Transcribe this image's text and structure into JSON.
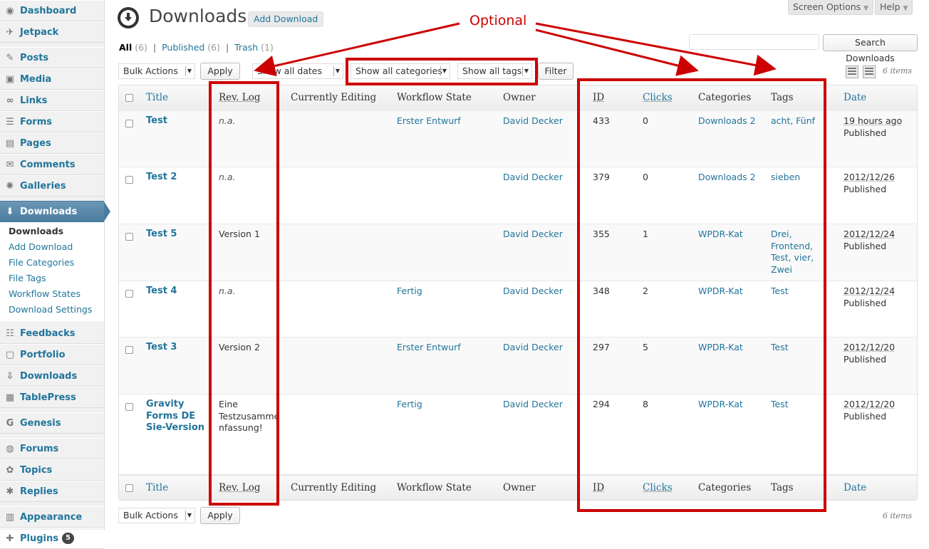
{
  "sidebar": {
    "menu": [
      {
        "label": "Dashboard",
        "icon": "dashboard-icon"
      },
      {
        "label": "Jetpack",
        "icon": "jetpack-icon"
      },
      {
        "label": "Posts",
        "icon": "pin-icon"
      },
      {
        "label": "Media",
        "icon": "media-icon"
      },
      {
        "label": "Links",
        "icon": "link-icon"
      },
      {
        "label": "Forms",
        "icon": "forms-icon"
      },
      {
        "label": "Pages",
        "icon": "pages-icon"
      },
      {
        "label": "Comments",
        "icon": "comment-icon"
      },
      {
        "label": "Galleries",
        "icon": "gallery-icon"
      },
      {
        "label": "Downloads",
        "icon": "download-icon"
      },
      {
        "label": "Feedbacks",
        "icon": "feedback-icon"
      },
      {
        "label": "Portfolio",
        "icon": "portfolio-icon"
      },
      {
        "label": "Downloads",
        "icon": "download-arrow-icon"
      },
      {
        "label": "TablePress",
        "icon": "table-icon"
      },
      {
        "label": "Genesis",
        "icon": "genesis-icon"
      },
      {
        "label": "Forums",
        "icon": "forums-icon"
      },
      {
        "label": "Topics",
        "icon": "topics-icon"
      },
      {
        "label": "Replies",
        "icon": "replies-icon"
      },
      {
        "label": "Appearance",
        "icon": "appearance-icon"
      },
      {
        "label": "Plugins",
        "icon": "plugin-icon",
        "badge": "5"
      }
    ],
    "submenu": [
      "Downloads",
      "Add Download",
      "File Categories",
      "File Tags",
      "Workflow States",
      "Download Settings"
    ]
  },
  "header": {
    "screen_options": "Screen Options",
    "help": "Help",
    "title": "Downloads",
    "add_new": "Add Download"
  },
  "views": {
    "all": "All",
    "all_count": "(6)",
    "published": "Published",
    "published_count": "(6)",
    "trash": "Trash",
    "trash_count": "(1)"
  },
  "search": {
    "button": "Search Downloads",
    "value": ""
  },
  "toolbar": {
    "bulk_actions": "Bulk Actions",
    "apply": "Apply",
    "dates": "Show all dates",
    "categories": "Show all categories",
    "tags": "Show all tags",
    "filter": "Filter",
    "items": "6 items"
  },
  "columns": {
    "title": "Title",
    "revlog": "Rev. Log",
    "editing": "Currently Editing",
    "workflow": "Workflow State",
    "owner": "Owner",
    "id": "ID",
    "clicks": "Clicks",
    "categories": "Categories",
    "tags": "Tags",
    "date": "Date"
  },
  "rows": [
    {
      "title": "Test",
      "revlog": "n.a.",
      "workflow": "Erster Entwurf",
      "owner": "David Decker",
      "id": "433",
      "clicks": "0",
      "categories": "Downloads 2",
      "tags": "acht, Fünf",
      "date": "19 hours ago",
      "status": "Published"
    },
    {
      "title": "Test 2",
      "revlog": "n.a.",
      "workflow": "",
      "owner": "David Decker",
      "id": "379",
      "clicks": "0",
      "categories": "Downloads 2",
      "tags": "sieben",
      "date": "2012/12/26",
      "status": "Published"
    },
    {
      "title": "Test 5",
      "revlog": "Version 1",
      "workflow": "",
      "owner": "David Decker",
      "id": "355",
      "clicks": "1",
      "categories": "WPDR-Kat",
      "tags": "Drei,\nFrontend,\nTest, vier,\nZwei",
      "date": "2012/12/24",
      "status": "Published"
    },
    {
      "title": "Test 4",
      "revlog": "n.a.",
      "workflow": "Fertig",
      "owner": "David Decker",
      "id": "348",
      "clicks": "2",
      "categories": "WPDR-Kat",
      "tags": "Test",
      "date": "2012/12/24",
      "status": "Published"
    },
    {
      "title": "Test 3",
      "revlog": "Version 2",
      "workflow": "Erster Entwurf",
      "owner": "David Decker",
      "id": "297",
      "clicks": "5",
      "categories": "WPDR-Kat",
      "tags": "Test",
      "date": "2012/12/20",
      "status": "Published"
    },
    {
      "title": "Gravity\nForms DE\nSie-Version",
      "revlog": "Eine\nTestzusamme\nnfassung!",
      "workflow": "Fertig",
      "owner": "David Decker",
      "id": "294",
      "clicks": "8",
      "categories": "WPDR-Kat",
      "tags": "Test",
      "date": "2012/12/20",
      "status": "Published"
    }
  ],
  "annotation": {
    "label": "Optional",
    "color": "#cc0000"
  }
}
